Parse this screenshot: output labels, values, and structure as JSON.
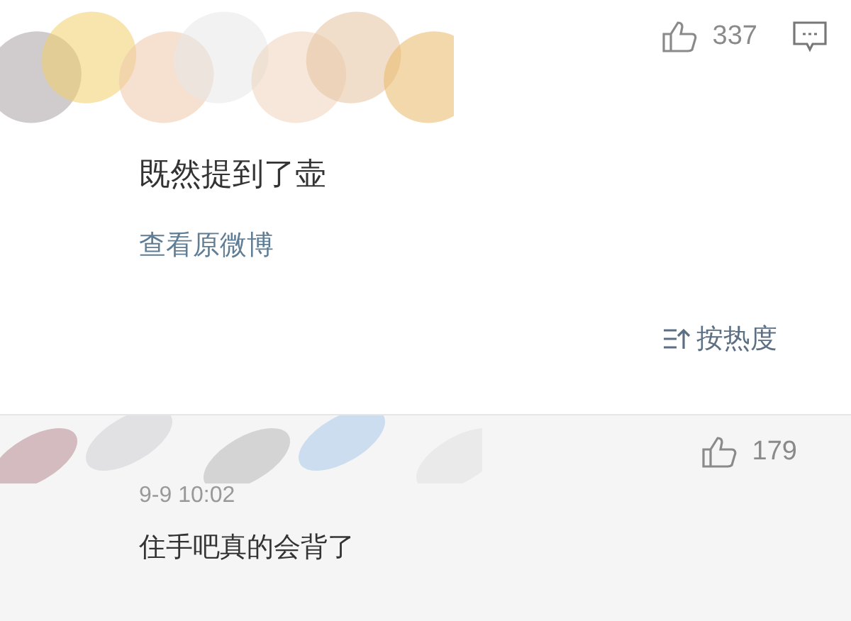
{
  "post": {
    "likes": "337",
    "text": "既然提到了壶",
    "link": "查看原微博"
  },
  "sort": {
    "label": "按热度"
  },
  "comments": [
    {
      "likes": "179",
      "time": "9-9 10:02",
      "text": "住手吧真的会背了"
    }
  ]
}
